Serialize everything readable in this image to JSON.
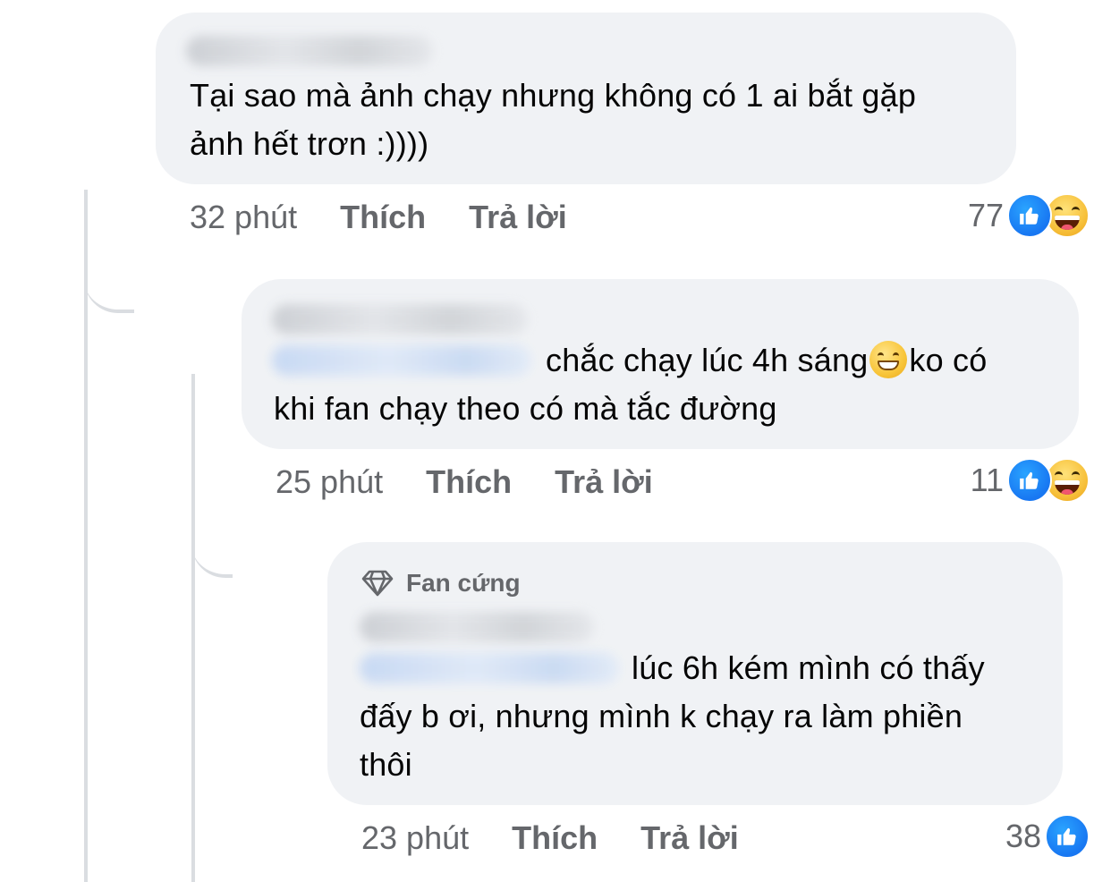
{
  "comments": [
    {
      "body": "Tại sao mà ảnh chạy nhưng không có 1 ai bắt gặp ảnh hết trơn :))))",
      "line1": "Tại sao mà ảnh chạy nhưng không có 1 ai bắt gặp",
      "line2": "ảnh hết trơn :))))",
      "time": "32 phút",
      "like_label": "Thích",
      "reply_label": "Trả lời",
      "reaction_count": "77",
      "reactions": [
        "like-icon",
        "haha-icon"
      ]
    },
    {
      "line1": "chắc chạy lúc 4h sáng",
      "line1_tail": "ko có",
      "line2": "khi fan chạy theo có mà tắc đường",
      "inline_emoji": "grinning-face-emoji",
      "time": "25 phút",
      "like_label": "Thích",
      "reply_label": "Trả lời",
      "reaction_count": "11",
      "reactions": [
        "like-icon",
        "haha-icon"
      ]
    },
    {
      "badge": "Fan cứng",
      "badge_icon": "diamond-icon",
      "line1": "lúc 6h kém mình có thấy",
      "line2": "đấy b ơi, nhưng mình k chạy ra làm phiền",
      "line3": "thôi",
      "time": "23 phút",
      "like_label": "Thích",
      "reply_label": "Trả lời",
      "reaction_count": "38",
      "reactions": [
        "like-icon"
      ]
    }
  ],
  "colors": {
    "bubble": "#f0f2f5",
    "meta_text": "#65676b",
    "like_blue": "#1877f2",
    "thread_line": "#dadde1"
  }
}
